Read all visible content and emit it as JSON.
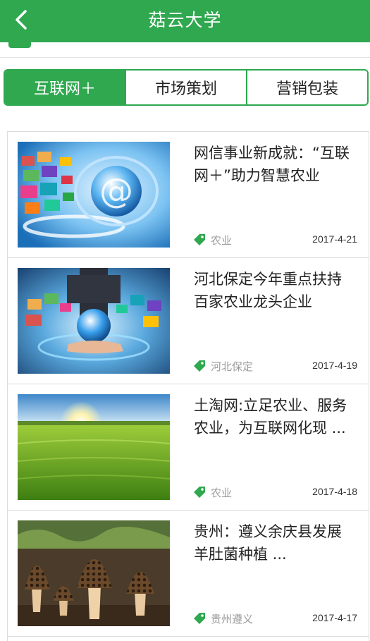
{
  "header": {
    "title": "菇云大学",
    "back_icon": "chevron-left-icon"
  },
  "tabs": [
    {
      "label": "互联网＋",
      "active": true
    },
    {
      "label": "市场策划",
      "active": false
    },
    {
      "label": "营销包装",
      "active": false
    }
  ],
  "articles": [
    {
      "title": "网信事业新成就：“互联网＋”助力智慧农业",
      "tag": "农业",
      "date": "2017-4-21",
      "image": "internet-globe-image"
    },
    {
      "title": "河北保定今年重点扶持百家农业龙头企业",
      "tag": "河北保定",
      "date": "2017-4-19",
      "image": "hand-globe-image"
    },
    {
      "title": "土淘网:立足农业、服务农业，为互联网化现 ...",
      "tag": "农业",
      "date": "2017-4-18",
      "image": "wheat-field-image"
    },
    {
      "title": "贵州：遵义余庆县发展羊肚菌种植 ...",
      "tag": "贵州遵义",
      "date": "2017-4-17",
      "image": "morel-mushroom-image"
    }
  ],
  "colors": {
    "brand": "#2fa84f",
    "tag_text": "#9a9a9a"
  }
}
